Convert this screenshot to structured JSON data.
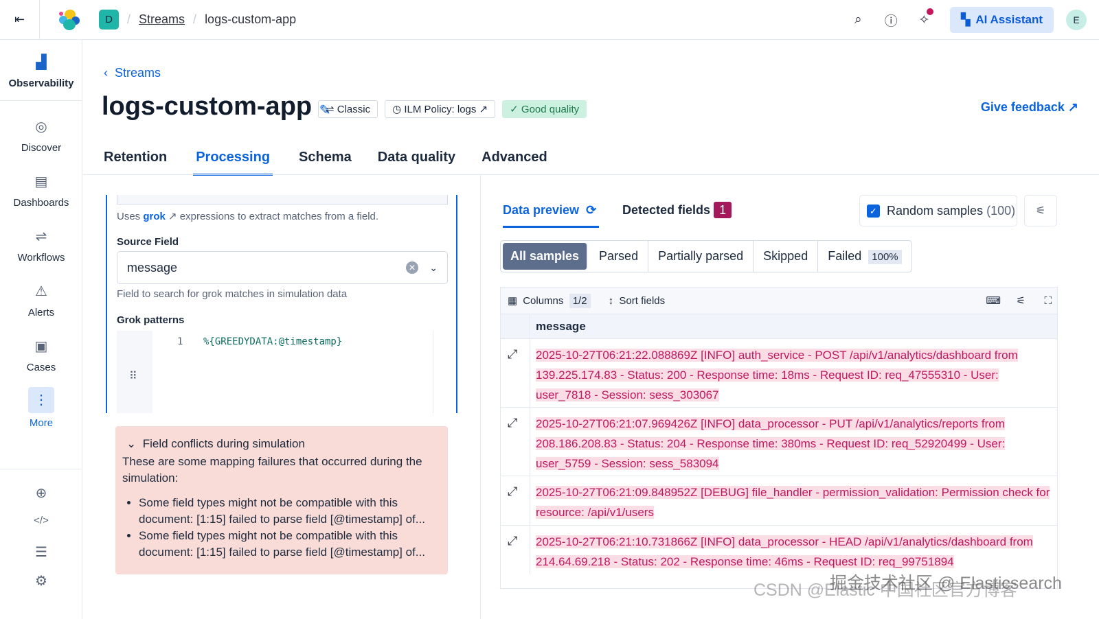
{
  "topbar": {
    "space_initial": "D",
    "breadcrumb_link": "Streams",
    "breadcrumb_current": "logs-custom-app",
    "ai_label": "AI Assistant",
    "avatar_initial": "E"
  },
  "sidenav": {
    "app": "Observability",
    "items": [
      {
        "label": "Discover",
        "icon": "compass"
      },
      {
        "label": "Dashboards",
        "icon": "dashboard"
      },
      {
        "label": "Workflows",
        "icon": "workflow"
      },
      {
        "label": "Alerts",
        "icon": "warning"
      },
      {
        "label": "Cases",
        "icon": "briefcase"
      },
      {
        "label": "More",
        "icon": "more"
      }
    ]
  },
  "page": {
    "back": "Streams",
    "title": "logs-custom-app",
    "badges": {
      "classic": "Classic",
      "ilm": "ILM Policy: logs",
      "quality": "Good quality"
    },
    "feedback": "Give feedback",
    "tabs": [
      "Retention",
      "Processing",
      "Schema",
      "Data quality",
      "Advanced"
    ]
  },
  "processor": {
    "uses_prefix": "Uses",
    "uses_link": "grok",
    "uses_suffix": "expressions to extract matches from a field.",
    "source_label": "Source Field",
    "source_value": "message",
    "source_help": "Field to search for grok matches in simulation data",
    "patterns_label": "Grok patterns",
    "line_no": "1",
    "pattern": "%{GREEDYDATA:@timestamp}"
  },
  "conflicts": {
    "title": "Field conflicts during simulation",
    "desc": "These are some mapping failures that occurred during the simulation:",
    "items": [
      "Some field types might not be compatible with this document: [1:15] failed to parse field [@timestamp] of...",
      "Some field types might not be compatible with this document: [1:15] failed to parse field [@timestamp] of..."
    ]
  },
  "preview": {
    "tab_preview": "Data preview",
    "tab_detected": "Detected fields",
    "detected_count": "1",
    "random_label": "Random samples",
    "random_count": "(100)",
    "filters": [
      "All samples",
      "Parsed",
      "Partially parsed",
      "Skipped",
      "Failed"
    ],
    "failed_pct": "100%",
    "columns_label": "Columns",
    "columns_count": "1/2",
    "sort_label": "Sort fields",
    "column_header": "message",
    "rows": [
      "2025-10-27T06:21:22.088869Z [INFO] auth_service - POST /api/v1/analytics/dashboard from 139.225.174.83 - Status: 200 - Response time: 18ms - Request ID: req_47555310 - User: user_7818 - Session: sess_303067",
      "2025-10-27T06:21:07.969426Z [INFO] data_processor - PUT /api/v1/analytics/reports from 208.186.208.83 - Status: 204 - Response time: 380ms - Request ID: req_52920499 - User: user_5759 - Session: sess_583094",
      "2025-10-27T06:21:09.848952Z [DEBUG] file_handler - permission_validation: Permission check for resource: /api/v1/users",
      "2025-10-27T06:21:10.731866Z [INFO] data_processor - HEAD /api/v1/analytics/dashboard from 214.64.69.218 - Status: 202 - Response time: 46ms - Request ID: req_99751894"
    ]
  },
  "watermarks": [
    "掘金技术社区 @ Elasticsearch",
    "CSDN @Elastic 中国社区官方博客"
  ]
}
